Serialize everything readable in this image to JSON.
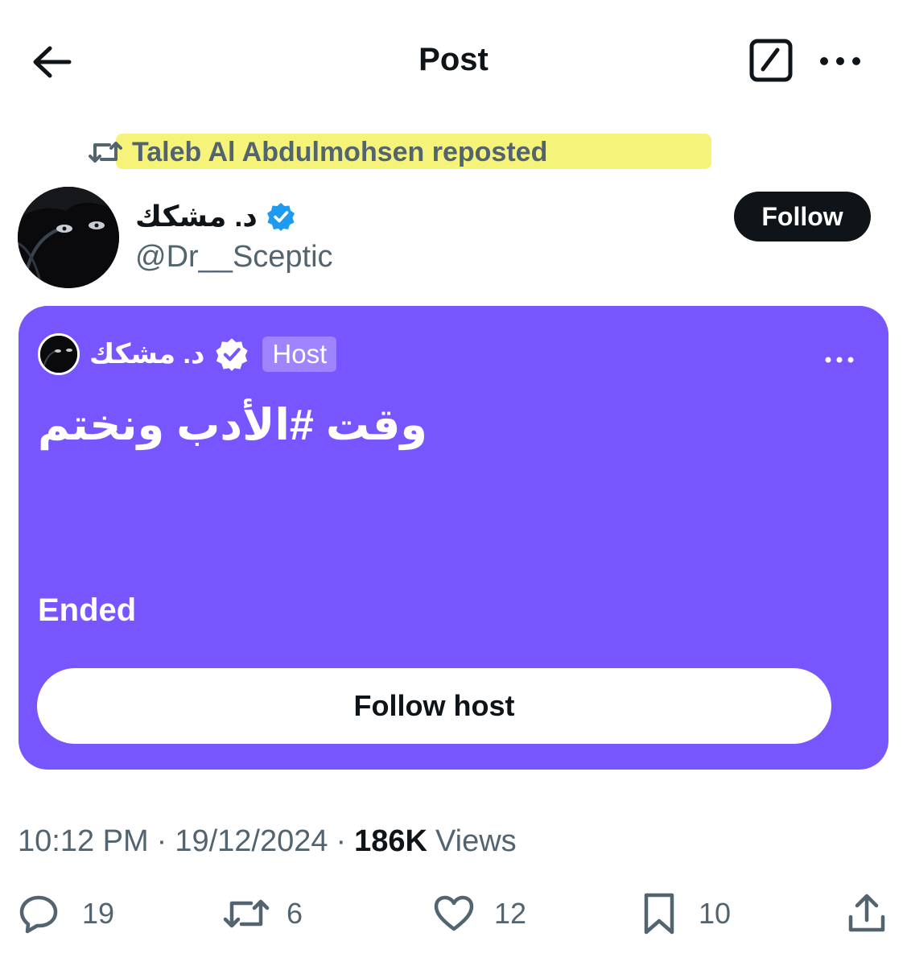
{
  "header": {
    "title": "Post",
    "back_icon": "arrow-left-icon",
    "edit_icon": "compose-icon",
    "more_icon": "more-horizontal-icon"
  },
  "repost": {
    "icon": "repost-icon",
    "text": "Taleb Al Abdulmohsen reposted",
    "highlight_color": "#f5f37a"
  },
  "author": {
    "name": "د. مشكك",
    "handle": "@Dr__Sceptic",
    "verified": true,
    "verified_color": "#1d9bf0",
    "follow_label": "Follow"
  },
  "space": {
    "background_color": "#7856ff",
    "host_name": "د. مشكك",
    "host_badge": "Host",
    "title": "وقت #الأدب ونختم",
    "status": "Ended",
    "follow_host_label": "Follow host"
  },
  "meta": {
    "time": "10:12 PM",
    "date": "19/12/2024",
    "separator": "·",
    "views_count": "186K",
    "views_label": "Views"
  },
  "actions": {
    "replies": "19",
    "reposts": "6",
    "likes": "12",
    "bookmarks": "10"
  }
}
